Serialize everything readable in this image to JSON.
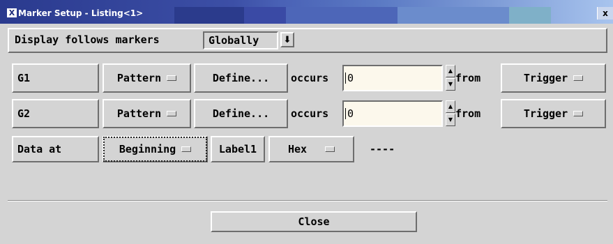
{
  "window": {
    "title": "Marker Setup - Listing<1>",
    "close_glyph": "x",
    "app_glyph": "X"
  },
  "display": {
    "label": "Display follows markers",
    "value": "Globally",
    "arrow_glyph": "⬇"
  },
  "rows": [
    {
      "name": "G1",
      "type": "Pattern",
      "define": "Define...",
      "occurs_label": "occurs",
      "occurs_value": "0",
      "from_label": "from",
      "from_value": "Trigger"
    },
    {
      "name": "G2",
      "type": "Pattern",
      "define": "Define...",
      "occurs_label": "occurs",
      "occurs_value": "0",
      "from_label": "from",
      "from_value": "Trigger"
    }
  ],
  "data_row": {
    "label": "Data at",
    "position": "Beginning",
    "label_name": "Label1",
    "format": "Hex",
    "value": "----"
  },
  "close_label": "Close",
  "spinner": {
    "up": "▲",
    "down": "▼"
  },
  "colors": {
    "title_start": "#2a3a8e",
    "title_end": "#a8c4ee",
    "background": "#d4d4d4",
    "field": "#fcf8ec"
  }
}
